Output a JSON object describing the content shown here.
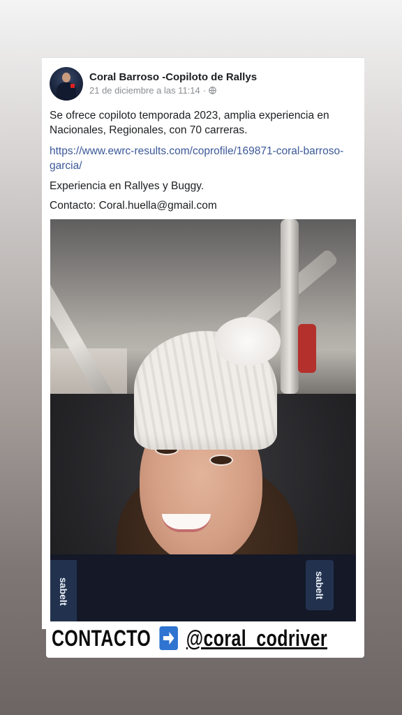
{
  "post": {
    "author": "Coral Barroso -Copiloto de Rallys",
    "timestamp": "21 de diciembre a las 11:14",
    "separator": "·",
    "paragraph1": "Se ofrece copiloto temporada 2023, amplia experiencia en Nacionales, Regionales, con 70 carreras.",
    "link": "https://www.ewrc-results.com/coprofile/169871-coral-barroso-garcia/",
    "paragraph2": "Experiencia en Rallyes y Buggy.",
    "paragraph3": "Contacto: Coral.huella@gmail.com",
    "photo_logo_text": "sabelt"
  },
  "banner": {
    "label": "CONTACTO",
    "arrow_icon": "right-arrow-emoji",
    "handle": "@coral_codriver"
  },
  "colors": {
    "link": "#3b5898",
    "meta": "#8a8d91",
    "arrow": "#2f74d0"
  }
}
